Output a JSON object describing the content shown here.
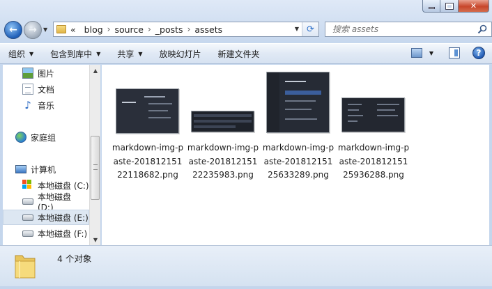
{
  "window": {
    "caption_buttons": [
      "minimize",
      "maximize",
      "close"
    ]
  },
  "address_bar": {
    "overflow": "«",
    "crumbs": [
      "blog",
      "source",
      "_posts",
      "assets"
    ]
  },
  "search": {
    "placeholder": "搜索 assets"
  },
  "commands": [
    "组织",
    "包含到库中",
    "共享",
    "放映幻灯片",
    "新建文件夹"
  ],
  "nav_pane": {
    "items": [
      {
        "label": "图片",
        "icon": "pictures-icon"
      },
      {
        "label": "文档",
        "icon": "documents-icon"
      },
      {
        "label": "音乐",
        "icon": "music-icon"
      },
      {
        "label": "家庭组",
        "icon": "homegroup-icon"
      },
      {
        "label": "计算机",
        "icon": "computer-icon"
      },
      {
        "label": "本地磁盘 (C:)",
        "icon": "system-drive-icon"
      },
      {
        "label": "本地磁盘 (D:)",
        "icon": "drive-icon"
      },
      {
        "label": "本地磁盘 (E:)",
        "icon": "drive-icon",
        "selected": true
      },
      {
        "label": "本地磁盘 (F:)",
        "icon": "drive-icon"
      }
    ]
  },
  "files": [
    {
      "name": "markdown-img-paste-20181215122118682.png"
    },
    {
      "name": "markdown-img-paste-20181215122235983.png"
    },
    {
      "name": "markdown-img-paste-20181215125633289.png"
    },
    {
      "name": "markdown-img-paste-20181215125936288.png"
    }
  ],
  "details": {
    "count_text": "4 个对象"
  },
  "colors": {
    "accent": "#2b6fc9",
    "thumb_bg": "#2b3140",
    "selected_bg": "#dde7f2"
  }
}
